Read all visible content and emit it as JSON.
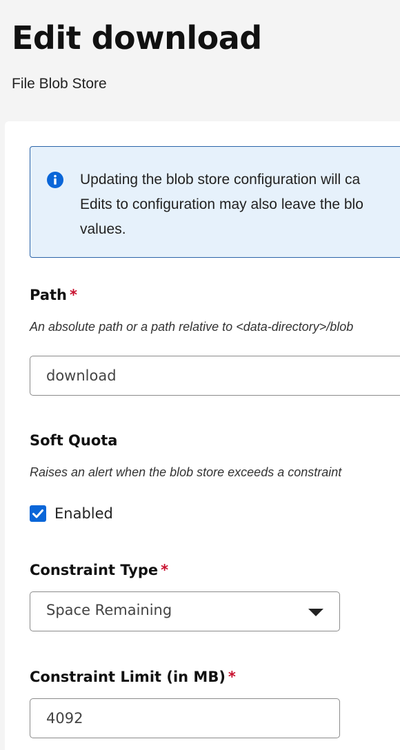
{
  "header": {
    "title": "Edit download",
    "subtitle": "File Blob Store"
  },
  "alert": {
    "icon": "info-icon",
    "lines": [
      "Updating the blob store configuration will ca",
      "Edits to configuration may also leave the blo",
      "values."
    ]
  },
  "form": {
    "path": {
      "label": "Path",
      "required_mark": "*",
      "help": "An absolute path or a path relative to <data-directory>/blob",
      "value": "download"
    },
    "soft_quota": {
      "label": "Soft Quota",
      "help": "Raises an alert when the blob store exceeds a constraint",
      "checkbox_label": "Enabled",
      "checked": true
    },
    "constraint_type": {
      "label": "Constraint Type",
      "required_mark": "*",
      "selected": "Space Remaining"
    },
    "constraint_limit": {
      "label": "Constraint Limit (in MB)",
      "required_mark": "*",
      "value": "4092"
    }
  },
  "colors": {
    "accent": "#0a66d8",
    "required": "#c8102e",
    "alert_bg": "#e6f1fb",
    "alert_border": "#2a63a8"
  }
}
